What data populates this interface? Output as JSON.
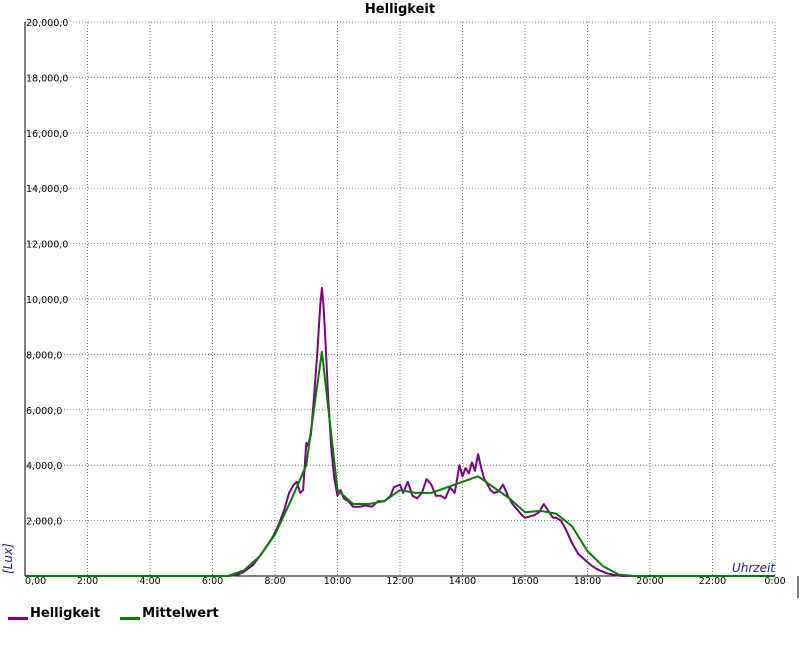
{
  "chart_data": {
    "type": "line",
    "title": "Helligkeit",
    "xlabel": "Uhrzeit",
    "ylabel": "[Lux]",
    "xlim": [
      0,
      24
    ],
    "ylim": [
      0,
      20000
    ],
    "grid": true,
    "legend_placement": "bottom-left",
    "x_tick_labels": [
      "0,00",
      "2:00",
      "4:00",
      "6:00",
      "8:00",
      "10:00",
      "12:00",
      "14:00",
      "16:00",
      "18:00",
      "20:00",
      "22:00",
      "0:00"
    ],
    "y_tick_labels": [
      "2,000,0",
      "4,000,0",
      "6,000,0",
      "8,000,0",
      "10,000,0",
      "12,000,0",
      "14,000,0",
      "16,000,0",
      "18,000,0",
      "20,000,0"
    ],
    "series": [
      {
        "name": "Helligkeit",
        "color": "#800080",
        "x": [
          0,
          6.5,
          6.8,
          7.0,
          7.3,
          7.6,
          7.9,
          8.1,
          8.3,
          8.45,
          8.6,
          8.7,
          8.8,
          8.9,
          9.0,
          9.05,
          9.15,
          9.25,
          9.35,
          9.45,
          9.5,
          9.55,
          9.6,
          9.7,
          9.8,
          9.9,
          10.0,
          10.1,
          10.2,
          10.35,
          10.5,
          10.7,
          10.9,
          11.1,
          11.3,
          11.5,
          11.7,
          11.8,
          12.0,
          12.1,
          12.25,
          12.4,
          12.55,
          12.7,
          12.85,
          13.0,
          13.15,
          13.3,
          13.45,
          13.6,
          13.75,
          13.9,
          14.0,
          14.1,
          14.2,
          14.3,
          14.4,
          14.5,
          14.6,
          14.7,
          14.8,
          14.9,
          15.0,
          15.15,
          15.3,
          15.45,
          15.6,
          15.75,
          15.9,
          16.0,
          16.15,
          16.3,
          16.45,
          16.6,
          16.75,
          16.9,
          17.0,
          17.15,
          17.3,
          17.5,
          17.7,
          17.9,
          18.1,
          18.3,
          18.6,
          18.9,
          19.1,
          19.3,
          24
        ],
        "y": [
          0,
          0,
          40,
          150,
          400,
          850,
          1350,
          1800,
          2400,
          3000,
          3300,
          3400,
          3000,
          3100,
          4800,
          4700,
          5100,
          6500,
          8000,
          9800,
          10400,
          9800,
          8800,
          6500,
          4600,
          3500,
          2900,
          3100,
          2800,
          2700,
          2500,
          2500,
          2550,
          2500,
          2700,
          2700,
          2900,
          3200,
          3300,
          3000,
          3400,
          2900,
          2800,
          3000,
          3500,
          3300,
          2900,
          2900,
          2800,
          3200,
          3000,
          4000,
          3600,
          3900,
          3700,
          4100,
          3800,
          4400,
          3900,
          3500,
          3300,
          3100,
          3000,
          3050,
          3300,
          2900,
          2600,
          2400,
          2200,
          2100,
          2150,
          2200,
          2300,
          2600,
          2350,
          2100,
          2100,
          2000,
          1700,
          1200,
          800,
          600,
          400,
          250,
          100,
          30,
          0,
          0,
          0
        ]
      },
      {
        "name": "Mittelwert",
        "color": "#008000",
        "x": [
          0,
          6.5,
          7.0,
          7.5,
          8.0,
          8.5,
          9.0,
          9.5,
          10.0,
          10.5,
          11.0,
          11.5,
          12.0,
          12.5,
          13.0,
          13.5,
          14.0,
          14.5,
          15.0,
          15.5,
          16.0,
          16.5,
          17.0,
          17.5,
          18.0,
          18.5,
          19.0,
          19.5,
          24
        ],
        "y": [
          0,
          0,
          200,
          700,
          1500,
          2700,
          4000,
          8100,
          3100,
          2600,
          2600,
          2700,
          3100,
          3000,
          3000,
          3200,
          3400,
          3600,
          3200,
          2800,
          2300,
          2350,
          2250,
          1800,
          900,
          350,
          50,
          0,
          0
        ]
      }
    ]
  }
}
